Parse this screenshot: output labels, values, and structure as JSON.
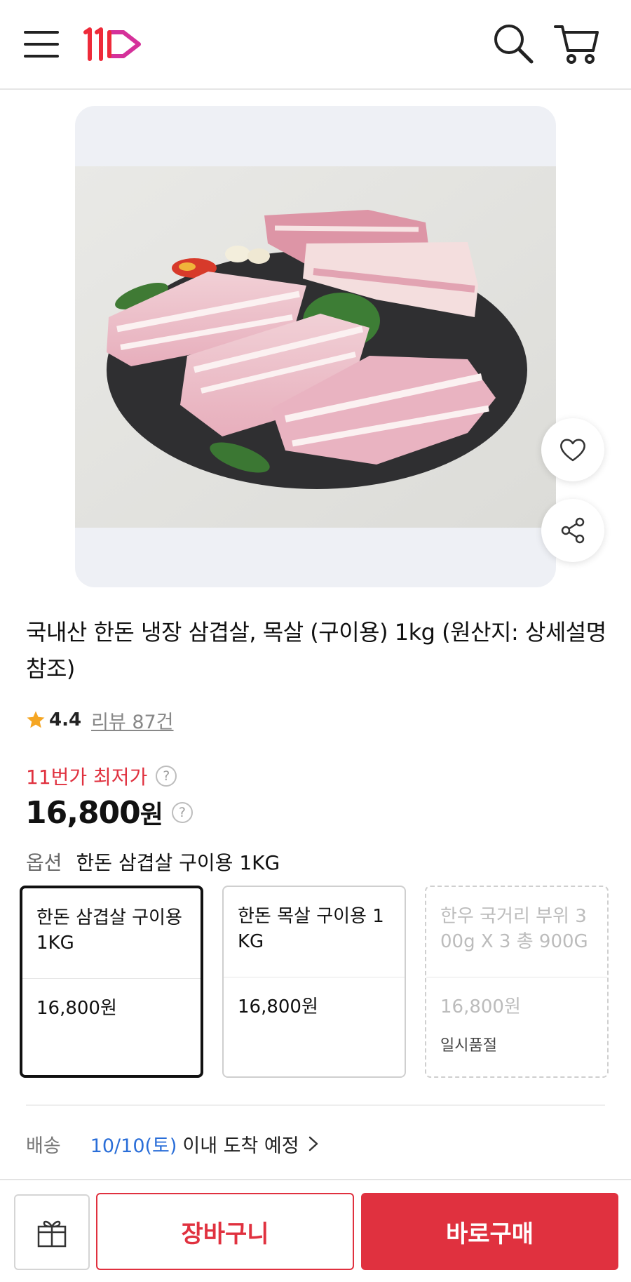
{
  "header": {
    "logo_text": "11",
    "icons": [
      "menu-icon",
      "logo-11st",
      "search-icon",
      "cart-icon"
    ]
  },
  "product": {
    "image": "pork-belly-photo",
    "title": "국내산 한돈 냉장 삼겹살, 목살 (구이용) 1kg (원산지: 상세설명 참조)",
    "rating": "4.4",
    "reviews": "리뷰 87건",
    "lowest_label": "11번가 최저가",
    "price_value": "16,800",
    "price_unit": "원",
    "help_glyph": "?"
  },
  "options": {
    "label": "옵션",
    "selected": "한돈 삼겹살 구이용 1KG",
    "items": [
      {
        "name": "한돈 삼겹살 구이용 1KG",
        "price": "16,800원",
        "status": ""
      },
      {
        "name": "한돈 목살 구이용 1KG",
        "price": "16,800원",
        "status": ""
      },
      {
        "name": "한우 국거리 부위 300g X 3 총 900G",
        "price": "16,800원",
        "status": "일시품절"
      }
    ]
  },
  "delivery": {
    "label": "배송",
    "date": "10/10(토)",
    "text": "이내 도착 예정"
  },
  "bottom_bar": {
    "cart_label": "장바구니",
    "buy_label": "바로구매"
  },
  "colors": {
    "accent_red": "#e0313f",
    "link_blue": "#2a6ed8",
    "star": "#f5a623"
  }
}
